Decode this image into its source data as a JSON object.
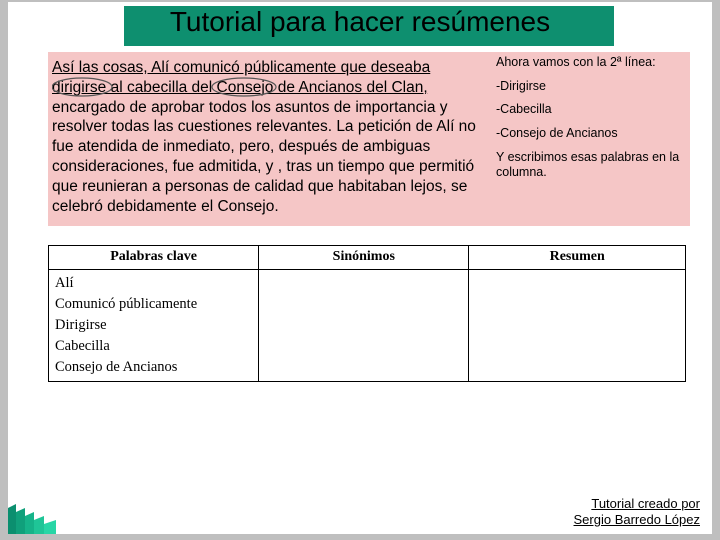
{
  "title": "Tutorial para hacer resúmenes",
  "paragraph": "Así las cosas, Alí comunicó públicamente que deseaba dirigirse al cabecilla del Consejo de Ancianos del Clan, encargado de aprobar todos los asuntos de importancia y resolver todas las cuestiones relevantes. La petición de Alí no fue atendida de inmediato, pero, después de ambiguas consideraciones, fue admitida, y , tras un tiempo que permitió que reunieran a personas de calidad que habitaban lejos, se celebró debidamente el Consejo.",
  "para_underlined_html": "<span class=\"u\">Así las cosas, Alí comunicó públicamente que deseaba dirigirse al cabecilla del Consejo de Ancianos del Clan,</span> encargado de aprobar todos los asuntos de importancia y resolver todas las cuestiones relevantes. La petición de Alí no fue atendida de inmediato, pero, después de ambiguas consideraciones, fue admitida, y , tras un tiempo que permitió que reunieran a personas de calidad que habitaban lejos, se celebró debidamente el Consejo.",
  "side": {
    "intro": "Ahora vamos con la 2ª línea:",
    "items": [
      "-Dirigirse",
      "-Cabecilla",
      "-Consejo de Ancianos"
    ],
    "note": "Y escribimos esas palabras en la columna."
  },
  "table": {
    "headers": [
      "Palabras clave",
      "Sinónimos",
      "Resumen"
    ],
    "col0_rows": [
      "Alí",
      "Comunicó públicamente",
      "Dirigirse",
      "Cabecilla",
      "Consejo de Ancianos"
    ]
  },
  "footer": {
    "line1": "Tutorial creado por",
    "line2": "Sergio Barredo López"
  }
}
